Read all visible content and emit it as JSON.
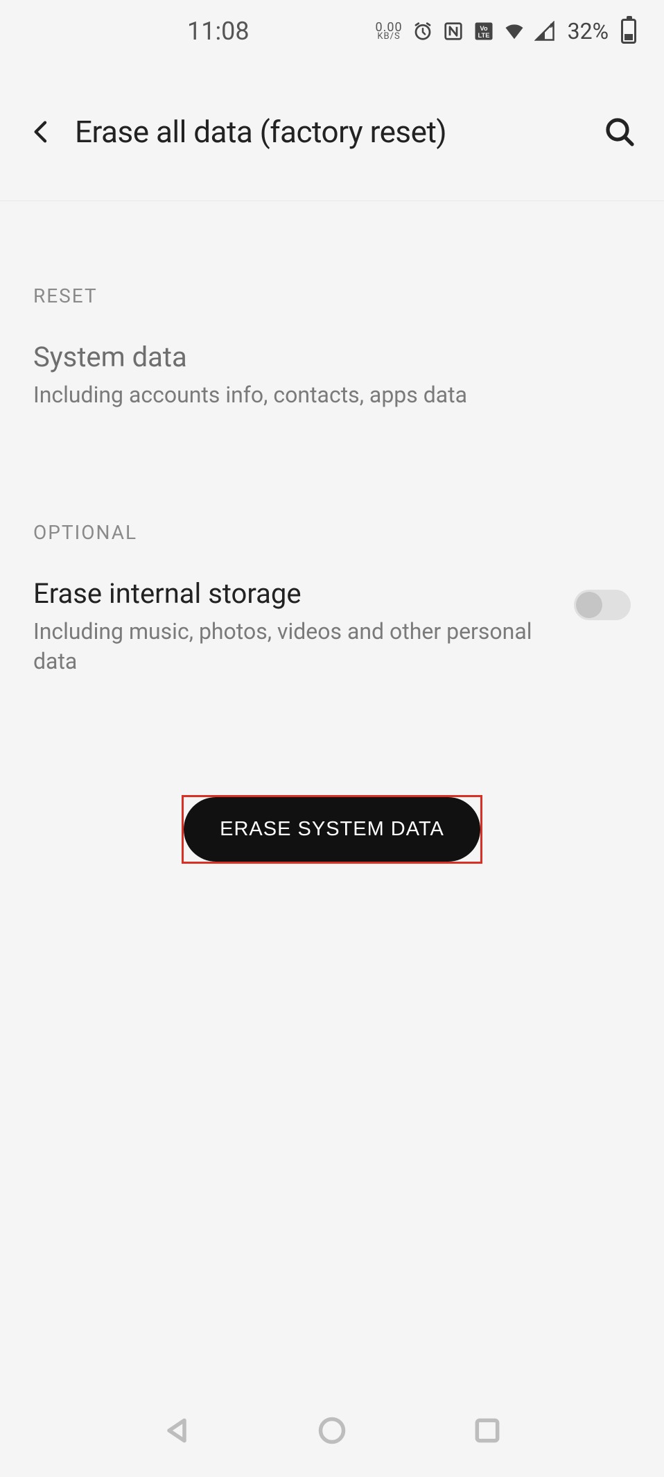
{
  "statusbar": {
    "time": "11:08",
    "net_speed_value": "0.00",
    "net_speed_unit": "KB/S",
    "battery_pct": "32%"
  },
  "header": {
    "title": "Erase all data (factory reset)"
  },
  "sections": {
    "reset": {
      "label": "RESET",
      "item_title": "System data",
      "item_desc": "Including accounts info, contacts, apps data"
    },
    "optional": {
      "label": "OPTIONAL",
      "item_title": "Erase internal storage",
      "item_desc": "Including music, photos, videos and other personal data",
      "toggle_on": false
    }
  },
  "button": {
    "label": "ERASE SYSTEM DATA"
  }
}
